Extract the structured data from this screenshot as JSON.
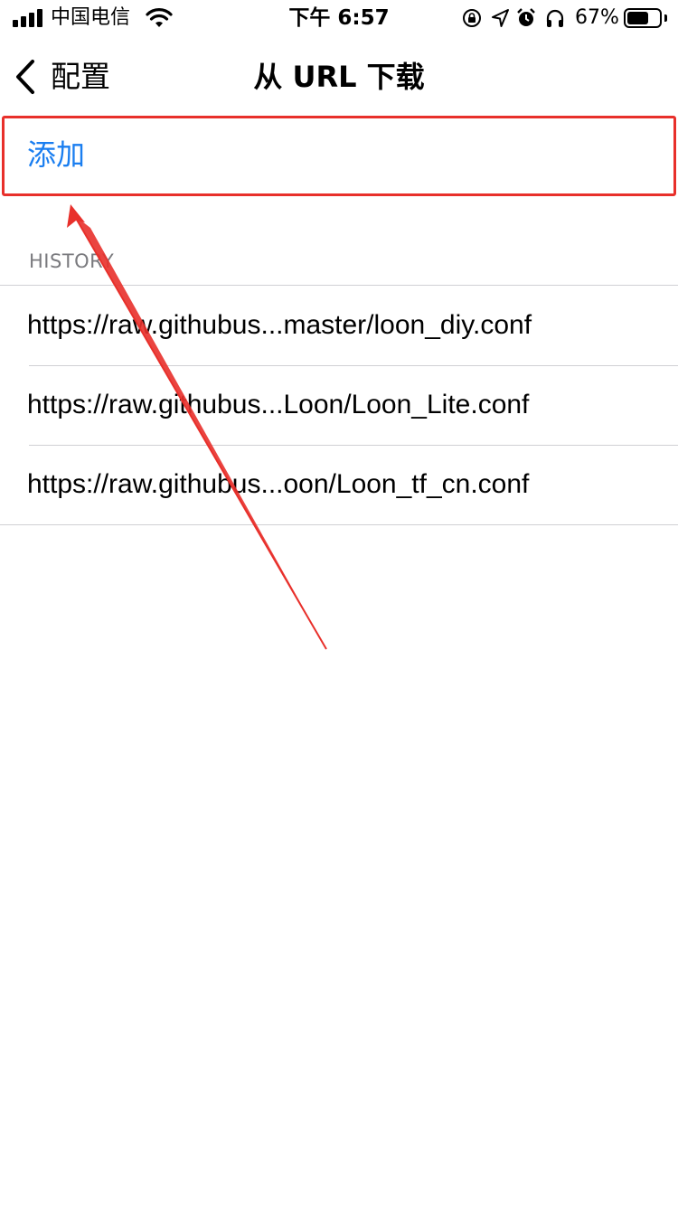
{
  "status_bar": {
    "carrier": "中国电信",
    "time": "下午 6:57",
    "battery_percent": "67%",
    "battery_level": 0.67,
    "icons": [
      "signal-icon",
      "wifi-icon",
      "orientation-lock-icon",
      "location-icon",
      "alarm-icon",
      "headphones-icon",
      "battery-icon"
    ]
  },
  "nav": {
    "back_label": "配置",
    "title": "从 URL 下载"
  },
  "add_label": "添加",
  "history": {
    "header": "HISTORY",
    "items": [
      "https://raw.githubus...master/loon_diy.conf",
      "https://raw.githubus...Loon/Loon_Lite.conf",
      "https://raw.githubus...oon/Loon_tf_cn.conf"
    ]
  },
  "colors": {
    "accent": "#1a7ef0",
    "annotation": "#e8302b",
    "separator": "#d0d0d4",
    "section_header": "#7a7a7e"
  }
}
